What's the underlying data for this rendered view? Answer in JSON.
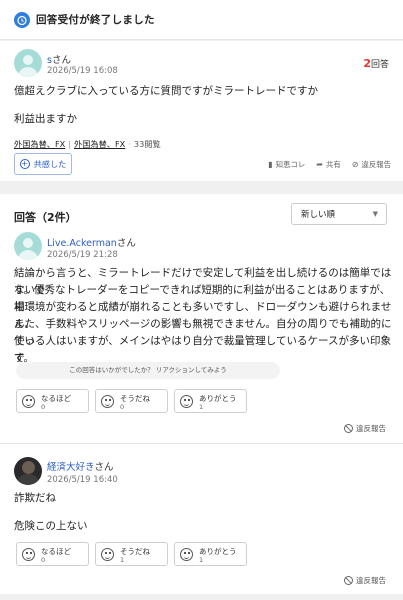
{
  "banner": {
    "text": "回答受付が終了しました",
    "icon": "alarm-clock-icon",
    "accent": "#2f7ddc"
  },
  "question": {
    "user": "s",
    "honorific": "さん",
    "datetime": "2026/5/19 16:08",
    "answer_count": "2",
    "answer_count_unit": "回答",
    "text_line1": "億超えクラブに入っている方に質問ですがミラートレードですか",
    "text_line2": "利益出ますか",
    "tags": [
      "外国為替、FX",
      "外国為替、FX"
    ],
    "views": "33閲覧",
    "empathy_label": "共感した",
    "actions": {
      "chiebukuro": "知恵コレ",
      "share": "共有",
      "report": "違反報告"
    }
  },
  "answers_section": {
    "header": "回答（2件）",
    "sort_selected": "新しい順",
    "items": [
      {
        "user": "Live.Ackerman",
        "honorific": "さん",
        "datetime": "2026/5/19 21:28",
        "lines": [
          "結論から言うと、ミラートレードだけで安定して利益を出し続けるのは簡単ではないで",
          "す。優秀なトレーダーをコピーできれば短期的に利益が出ることはありますが、相",
          "場環境が変わると成績が崩れることも多いですし、ドローダウンも避けられません。",
          "また、手数料やスリッページの影響も無視できません。自分の周りでも補助的に使っ",
          "ている人はいますが、メインはやはり自分で裁量管理しているケースが多い印象で",
          "す。"
        ],
        "prompt": "この回答はいかがでしたか？ リアクションしてみよう",
        "reactions": [
          {
            "label": "なるほど",
            "count": "0"
          },
          {
            "label": "そうだね",
            "count": "0"
          },
          {
            "label": "ありがとう",
            "count": "1"
          }
        ],
        "report": "違反報告"
      },
      {
        "user": "経済大好き",
        "honorific": "さん",
        "datetime": "2026/5/19 16:40",
        "line1": "詐欺だね",
        "line2": "危険この上ない",
        "reactions": [
          {
            "label": "なるほど",
            "count": "0"
          },
          {
            "label": "そうだね",
            "count": "1"
          },
          {
            "label": "ありがとう",
            "count": "1"
          }
        ],
        "report": "違反報告"
      }
    ]
  },
  "colors": {
    "link": "#2a5ec4",
    "count_red": "#e0362b",
    "background": "#f0f0f0"
  }
}
